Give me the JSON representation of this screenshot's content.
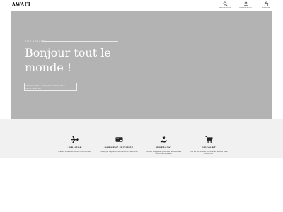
{
  "header": {
    "logo": "AWAFI",
    "actions": [
      {
        "label": "RECHERCHE",
        "icon": "search-icon"
      },
      {
        "label": "CONNEXION",
        "icon": "user-icon"
      },
      {
        "label": "PANIER",
        "icon": "bag-icon"
      }
    ]
  },
  "hero": {
    "kicker": "CHIC & CLASSE",
    "title": "Bonjour tout le monde !",
    "cta": "DÉCOUVREZ NOS NOUVEAUTÉS MAINTENANT"
  },
  "features": [
    {
      "title": "LIVRAISON",
      "desc": "Gratuite à partir de 50000 XOF d'achats",
      "icon": "airplane-icon"
    },
    {
      "title": "PAIEMENT SÉCURISÉ",
      "desc": "Payez par Paypal et nos Cartes de Paiements",
      "icon": "payment-card-icon"
    },
    {
      "title": "GIVEBACK",
      "desc": "Diffusez des gestes positifs et favorisez des rencontres amicales",
      "icon": "hand-heart-icon"
    },
    {
      "title": "DISCOUNT",
      "desc": "20% sur les produits commandés avec le code: AWAFI-20",
      "icon": "cart-icon"
    }
  ],
  "colors": {
    "hero_bg": "#b3b3b3",
    "features_bg": "#f1f1f1",
    "text_dark": "#222222"
  }
}
